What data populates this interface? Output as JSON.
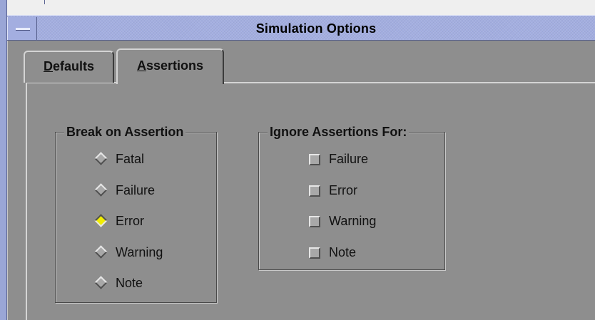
{
  "window": {
    "title": "Simulation Options"
  },
  "tabs": [
    {
      "label_u": "D",
      "label_rest": "efaults",
      "active": false
    },
    {
      "label_u": "A",
      "label_rest": "ssertions",
      "active": true
    }
  ],
  "break_group": {
    "title": "Break on Assertion",
    "options": [
      {
        "label": "Fatal",
        "selected": false
      },
      {
        "label": "Failure",
        "selected": false
      },
      {
        "label": "Error",
        "selected": true
      },
      {
        "label": "Warning",
        "selected": false
      },
      {
        "label": "Note",
        "selected": false
      }
    ]
  },
  "ignore_group": {
    "title": "Ignore Assertions For:",
    "options": [
      {
        "label": "Failure",
        "checked": false
      },
      {
        "label": "Error",
        "checked": false
      },
      {
        "label": "Warning",
        "checked": false
      },
      {
        "label": "Note",
        "checked": false
      }
    ]
  },
  "colors": {
    "body": "#8e8e8e",
    "titlebar": "#a3aee0",
    "selected_radio": "#f2ee00"
  }
}
